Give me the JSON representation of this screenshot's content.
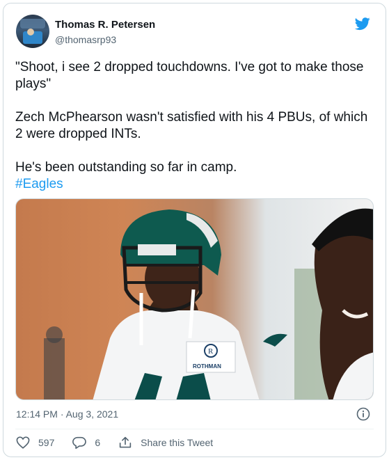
{
  "author": {
    "name": "Thomas R. Petersen",
    "handle": "@thomasrp93"
  },
  "tweet": {
    "paragraphs": [
      "\"Shoot, i see 2 dropped touchdowns. I've got to make those plays\"",
      "Zech McPhearson wasn't satisfied with his 4 PBUs, of which 2 were dropped INTs.",
      "He's been outstanding so far in camp."
    ],
    "hashtag": "#Eagles",
    "timestamp": "12:14 PM · Aug 3, 2021"
  },
  "media": {
    "jersey_logo_letter": "R",
    "jersey_logo_text": "ROTHMAN"
  },
  "actions": {
    "likes": "597",
    "replies": "6",
    "share_label": "Share this Tweet"
  },
  "colors": {
    "accent": "#1d9bf0",
    "text": "#0f1419",
    "secondary": "#536471"
  }
}
